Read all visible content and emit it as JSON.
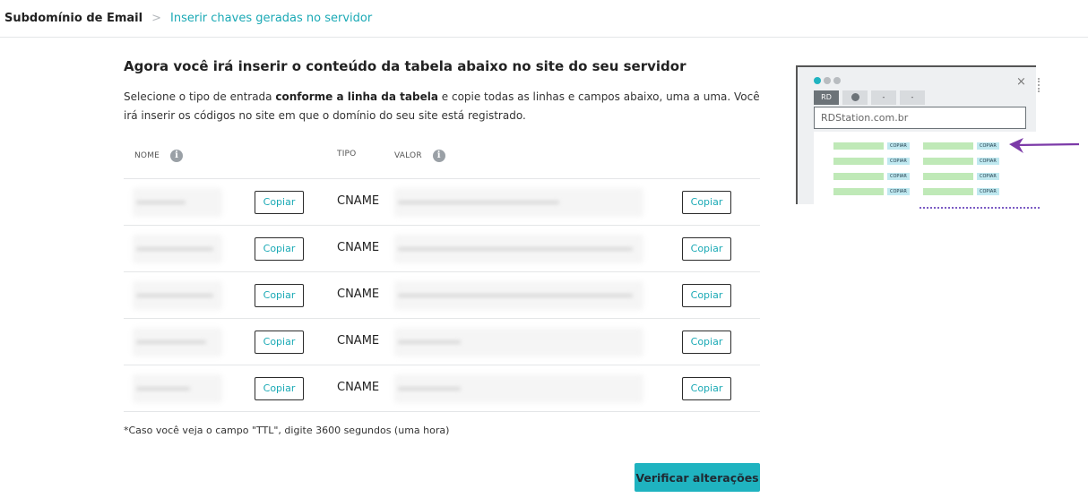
{
  "breadcrumb": {
    "root": "Subdomínio de Email",
    "separator": ">",
    "current": "Inserir chaves geradas no servidor"
  },
  "main": {
    "title": "Agora você irá inserir o conteúdo da tabela abaixo no site do seu servidor",
    "desc_part1": "Selecione o tipo de entrada ",
    "desc_bold": "conforme a linha da tabela",
    "desc_part2": " e copie todas as linhas e campos abaixo, uma a uma. Você irá inserir os códigos no site em que o domínio do seu site está registrado."
  },
  "table": {
    "headers": {
      "name": "NOME",
      "type": "TIPO",
      "value": "VALOR"
    },
    "info_icon": "info-icon",
    "copy_label": "Copiar",
    "rows": [
      {
        "type": "CNAME"
      },
      {
        "type": "CNAME"
      },
      {
        "type": "CNAME"
      },
      {
        "type": "CNAME"
      },
      {
        "type": "CNAME"
      }
    ]
  },
  "note": "*Caso você veja o campo \"TTL\", digite 3600 segundos (uma hora)",
  "verify_label": "Verificar alterações",
  "illustration": {
    "tab_label": "RD",
    "tab_dash": "-",
    "url": "RDStation.com.br",
    "copy_small": "COPIAR",
    "close": "×",
    "accent": "#7c3aa8",
    "brand": "#1fb3c0"
  }
}
